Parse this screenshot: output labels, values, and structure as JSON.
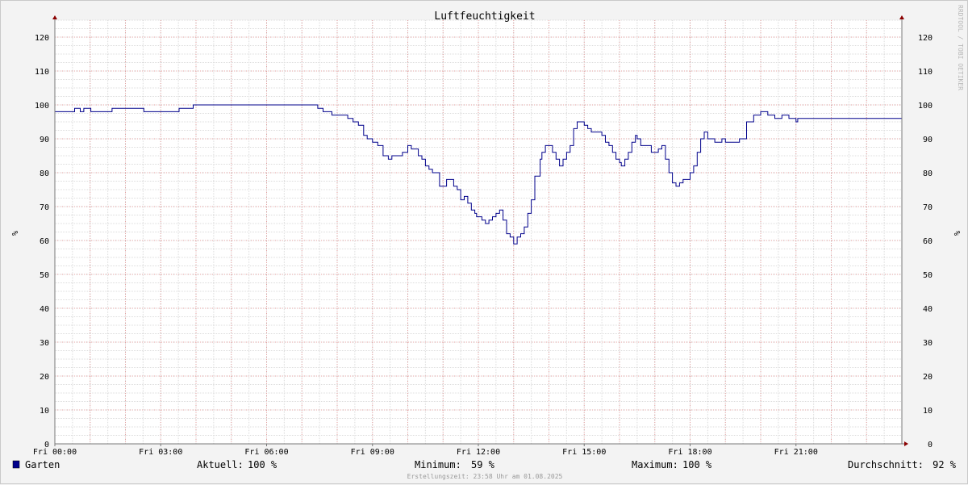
{
  "chart_data": {
    "type": "line",
    "title": "Luftfeuchtigkeit",
    "ylabel": "%",
    "ylim": [
      0,
      125
    ],
    "y_ticks": [
      0,
      10,
      20,
      30,
      40,
      50,
      60,
      70,
      80,
      90,
      100,
      110,
      120
    ],
    "x_tick_labels": [
      "Fri 00:00",
      "Fri 03:00",
      "Fri 06:00",
      "Fri 09:00",
      "Fri 12:00",
      "Fri 15:00",
      "Fri 18:00",
      "Fri 21:00"
    ],
    "x_tick_hours": [
      0,
      3,
      6,
      9,
      12,
      15,
      18,
      21
    ],
    "xlim_hours": [
      0,
      24
    ],
    "grid": true,
    "series": [
      {
        "name": "Garten",
        "color": "#00008b",
        "x_hours": [
          0,
          0.55,
          0.56,
          0.7,
          0.72,
          0.8,
          0.82,
          1.0,
          1.02,
          1.6,
          1.62,
          2.5,
          2.52,
          3.5,
          3.52,
          3.9,
          3.92,
          7.4,
          7.45,
          7.6,
          7.8,
          7.85,
          8.2,
          8.3,
          8.45,
          8.6,
          8.75,
          8.85,
          9.0,
          9.15,
          9.3,
          9.45,
          9.55,
          9.6,
          9.7,
          9.85,
          10.0,
          10.05,
          10.1,
          10.2,
          10.3,
          10.4,
          10.5,
          10.6,
          10.7,
          10.8,
          10.9,
          11.0,
          11.1,
          11.2,
          11.3,
          11.4,
          11.5,
          11.55,
          11.6,
          11.7,
          11.8,
          11.9,
          11.95,
          12.0,
          12.1,
          12.2,
          12.25,
          12.3,
          12.4,
          12.5,
          12.6,
          12.7,
          12.8,
          12.9,
          13.0,
          13.1,
          13.2,
          13.3,
          13.4,
          13.5,
          13.6,
          13.75,
          13.8,
          13.9,
          14.0,
          14.1,
          14.2,
          14.3,
          14.4,
          14.5,
          14.6,
          14.7,
          14.8,
          14.9,
          15.0,
          15.1,
          15.2,
          15.3,
          15.4,
          15.5,
          15.6,
          15.7,
          15.8,
          15.9,
          16.0,
          16.05,
          16.15,
          16.25,
          16.35,
          16.45,
          16.5,
          16.6,
          16.7,
          16.8,
          16.9,
          17.0,
          17.1,
          17.2,
          17.3,
          17.4,
          17.5,
          17.6,
          17.7,
          17.8,
          17.9,
          18.0,
          18.1,
          18.2,
          18.3,
          18.4,
          18.5,
          18.6,
          18.7,
          18.8,
          18.9,
          19.0,
          19.2,
          19.4,
          19.6,
          19.8,
          20.0,
          20.2,
          20.4,
          20.6,
          20.8,
          21.0,
          21.05,
          24.0
        ],
        "values": [
          98,
          98,
          99,
          99,
          98,
          98,
          99,
          99,
          98,
          98,
          99,
          99,
          98,
          98,
          99,
          99,
          100,
          100,
          99,
          98,
          98,
          97,
          97,
          96,
          95,
          94,
          91,
          90,
          89,
          88,
          85,
          84,
          85,
          85,
          85,
          86,
          88,
          88,
          87,
          87,
          85,
          84,
          82,
          81,
          80,
          80,
          76,
          76,
          78,
          78,
          76,
          75,
          72,
          72,
          73,
          71,
          69,
          68,
          67,
          67,
          66,
          65,
          65,
          66,
          67,
          68,
          69,
          66,
          62,
          61,
          59,
          61,
          62,
          64,
          68,
          72,
          79,
          84,
          86,
          88,
          88,
          86,
          84,
          82,
          84,
          86,
          88,
          93,
          95,
          95,
          94,
          93,
          92,
          92,
          92,
          91,
          89,
          88,
          86,
          84,
          83,
          82,
          84,
          86,
          89,
          91,
          90,
          88,
          88,
          88,
          86,
          86,
          87,
          88,
          84,
          80,
          77,
          76,
          77,
          78,
          78,
          80,
          82,
          86,
          90,
          92,
          90,
          90,
          89,
          89,
          90,
          89,
          89,
          90,
          95,
          97,
          98,
          97,
          96,
          97,
          96,
          95,
          96,
          96,
          97,
          98,
          99,
          100,
          100
        ]
      }
    ]
  },
  "legend": {
    "series_label": "Garten",
    "current_label": "Aktuell:",
    "current_value": "100 %",
    "min_label": "Minimum:",
    "min_value": "59 %",
    "max_label": "Maximum:",
    "max_value": "100 %",
    "avg_label": "Durchschnitt:",
    "avg_value": "92 %"
  },
  "footer": {
    "created": "Erstellungszeit: 23:58 Uhr am 01.08.2025"
  },
  "watermark": "RRDTOOL / TOBI OETIKER"
}
